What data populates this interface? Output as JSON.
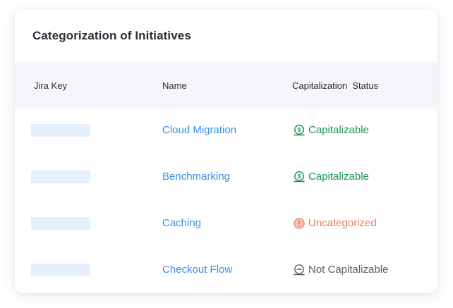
{
  "card": {
    "title": "Categorization of Initiatives"
  },
  "table": {
    "columns": [
      "Jira Key",
      "Name",
      "Capitalization  Status"
    ],
    "rows": [
      {
        "name": "Cloud Migration",
        "status": "Capitalizable",
        "status_type": "capitalizable",
        "status_icon": "dollar-coin-icon"
      },
      {
        "name": "Benchmarking",
        "status": "Capitalizable",
        "status_type": "capitalizable",
        "status_icon": "dollar-coin-icon"
      },
      {
        "name": "Caching",
        "status": "Uncategorized",
        "status_type": "uncategorized",
        "status_icon": "alert-circle-icon"
      },
      {
        "name": "Checkout Flow",
        "status": "Not Capitalizable",
        "status_type": "not-capitalizable",
        "status_icon": "minus-coin-icon"
      }
    ]
  },
  "colors": {
    "capitalizable": "#1f9254",
    "uncategorized": "#e87a5d",
    "not_capitalizable": "#5b5f6a",
    "link": "#3a8ee6",
    "header_bg": "#f6f5fc",
    "key_placeholder": "#e6effc"
  }
}
